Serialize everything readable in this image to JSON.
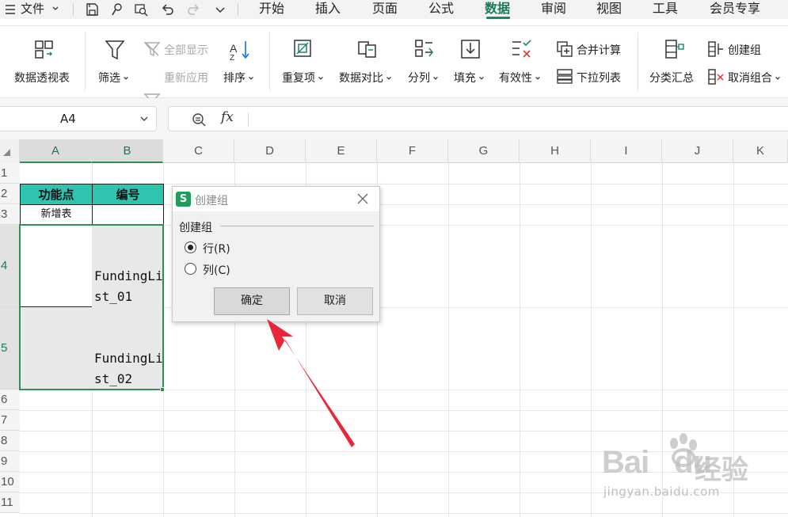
{
  "menubar": {
    "file_label": "文件",
    "tabs": [
      {
        "label": "开始"
      },
      {
        "label": "插入"
      },
      {
        "label": "页面"
      },
      {
        "label": "公式"
      },
      {
        "label": "数据"
      },
      {
        "label": "审阅"
      },
      {
        "label": "视图"
      },
      {
        "label": "工具"
      },
      {
        "label": "会员专享"
      }
    ],
    "active_tab": "数据",
    "accent_color": "#1a8a5e"
  },
  "ribbon": {
    "pivot": "数据透视表",
    "filter": "筛选",
    "show_all": "全部显示",
    "reapply": "重新应用",
    "sort": "排序",
    "duplicates": "重复项",
    "compare": "数据对比",
    "split": "分列",
    "fill": "填充",
    "validity": "有效性",
    "consolidate": "合并计算",
    "dropdown_list": "下拉列表",
    "subtotal": "分类汇总",
    "create_group": "创建组",
    "ungroup": "取消组合"
  },
  "formula_bar": {
    "name_box": "A4",
    "fx": "fx"
  },
  "grid": {
    "columns": [
      "A",
      "B",
      "C",
      "D",
      "E",
      "F",
      "G",
      "H",
      "I",
      "J",
      "K"
    ],
    "rows": [
      "1",
      "2",
      "3",
      "4",
      "5",
      "6",
      "7",
      "8",
      "9",
      "10",
      "11"
    ],
    "cells": {
      "A2": "功能点",
      "B2": "编号",
      "A3": "新增表",
      "B4": "FundingList_01",
      "B5": "FundingList_02"
    },
    "header_fill": "#2ec4b0",
    "selection_color": "#2f8f57"
  },
  "dialog": {
    "title": "创建组",
    "group_label": "创建组",
    "options": [
      {
        "label": "行(R)",
        "checked": true
      },
      {
        "label": "列(C)",
        "checked": false
      }
    ],
    "ok": "确定",
    "cancel": "取消",
    "app_icon_letter": "S"
  },
  "annotation": {
    "arrow_color": "#e8283a"
  },
  "watermark": {
    "brand": "Bai",
    "brand_suffix": "du",
    "chinese": "经验",
    "url": "jingyan.baidu.com"
  }
}
